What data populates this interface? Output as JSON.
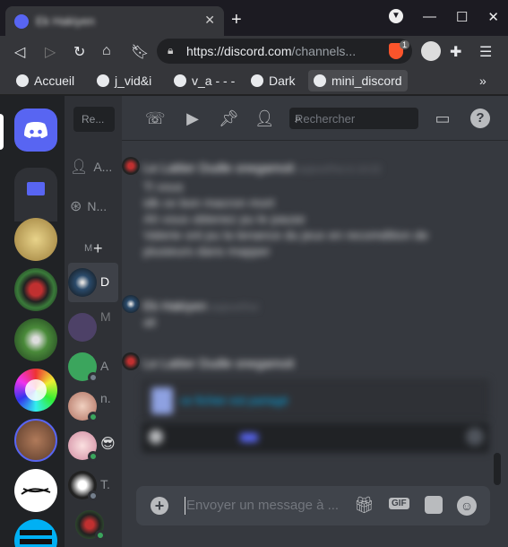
{
  "browser": {
    "tab_title": "Ek Hakiyen",
    "new_tab": "+",
    "url_host": "https://discord.com",
    "url_path": "/channels...",
    "brave_count": "1"
  },
  "bookmarks": [
    {
      "label": "Accueil"
    },
    {
      "label": "j_vid&i"
    },
    {
      "label": "v_a - - -"
    },
    {
      "label": "Dark"
    },
    {
      "label": "mini_discord"
    }
  ],
  "bookmarks_more": "»",
  "channels": {
    "search_placeholder": "Re...",
    "friends_label": "A...",
    "nitro_label": "N...",
    "dm_header": "M",
    "dm_add": "+",
    "dms": [
      {
        "initial": "D"
      },
      {
        "initial": "M"
      },
      {
        "initial": "A"
      },
      {
        "initial": "n."
      },
      {
        "initial": ""
      },
      {
        "initial": "T."
      },
      {
        "initial": ""
      }
    ]
  },
  "header": {
    "search_placeholder": "Rechercher",
    "help_label": "?"
  },
  "messages": [
    {
      "author": "Le Lattier Dudle onegamoit",
      "time": "aujourd'hui à 14:22",
      "lines": [
        "Ti vous",
        "idk ce bon macron mort",
        "Ah vous obtenez pu le pause",
        "Valerie ont pu la tenance du jeux en recomdition de",
        "plusieurs dans mapper"
      ]
    },
    {
      "author": "Ek Hakiyen",
      "time": "aujourd'hui",
      "lines": [
        "ali"
      ]
    },
    {
      "author": "Le Lattier Dudle onegamoit",
      "time": "aujourd'hui à 14:22",
      "lines": [
        "ce fichier est partagé"
      ]
    }
  ],
  "composer": {
    "placeholder": "Envoyer un message à ...",
    "gif_label": "GIF"
  },
  "colors": {
    "blurple": "#5865f2",
    "online": "#3ba55d",
    "bg_main": "#36393f",
    "bg_guilds": "#202225"
  }
}
